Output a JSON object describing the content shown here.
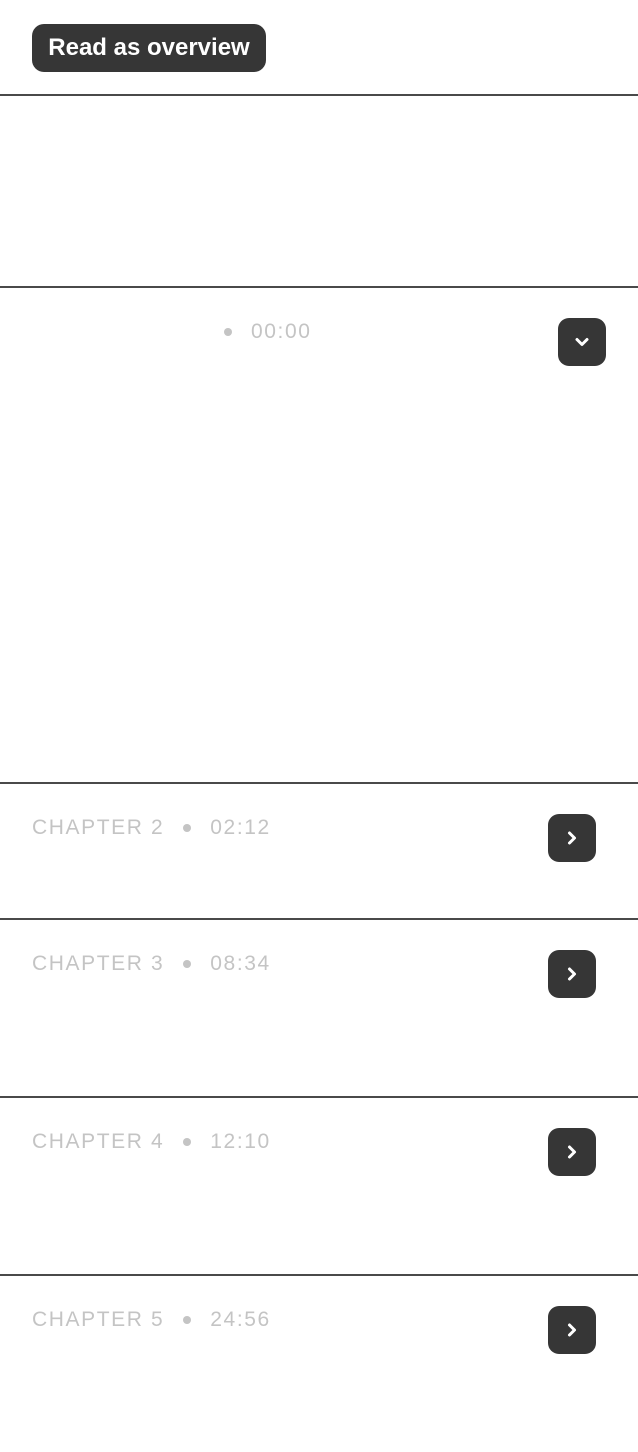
{
  "header": {
    "overview_button_label": "Read as overview"
  },
  "chapters": [
    {
      "label": "",
      "time": "00:00",
      "expanded": true,
      "toggle_icon": "chevron-down-icon"
    },
    {
      "label": "CHAPTER 2",
      "time": "02:12",
      "expanded": false,
      "toggle_icon": "chevron-right-icon"
    },
    {
      "label": "CHAPTER 3",
      "time": "08:34",
      "expanded": false,
      "toggle_icon": "chevron-right-icon"
    },
    {
      "label": "CHAPTER 4",
      "time": "12:10",
      "expanded": false,
      "toggle_icon": "chevron-right-icon"
    },
    {
      "label": "CHAPTER 5",
      "time": "24:56",
      "expanded": false,
      "toggle_icon": "chevron-right-icon"
    }
  ],
  "colors": {
    "button_background": "#363636",
    "divider": "#4a4a4a",
    "meta_text": "#c4c4c4",
    "background": "#ffffff"
  }
}
